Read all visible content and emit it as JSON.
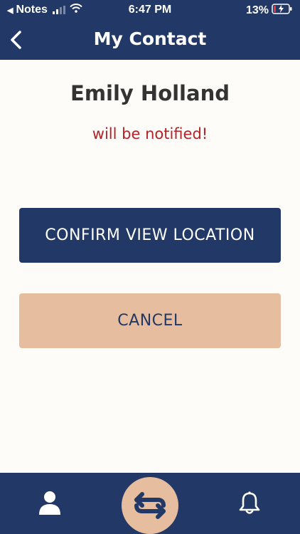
{
  "status_bar": {
    "back_app": "Notes",
    "time": "6:47 PM",
    "battery": "13%"
  },
  "header": {
    "title": "My Contact"
  },
  "contact": {
    "name": "Emily Holland",
    "notice": "will be notified!"
  },
  "actions": {
    "confirm_label": "CONFIRM VIEW LOCATION",
    "cancel_label": "CANCEL"
  },
  "tab_bar": {
    "items": [
      {
        "icon": "person-icon"
      },
      {
        "icon": "swap-arrows-icon"
      },
      {
        "icon": "bell-icon"
      }
    ]
  },
  "colors": {
    "primary": "#223866",
    "accent": "#e6bd9e",
    "alert": "#b52227",
    "background": "#fdfcf8"
  }
}
